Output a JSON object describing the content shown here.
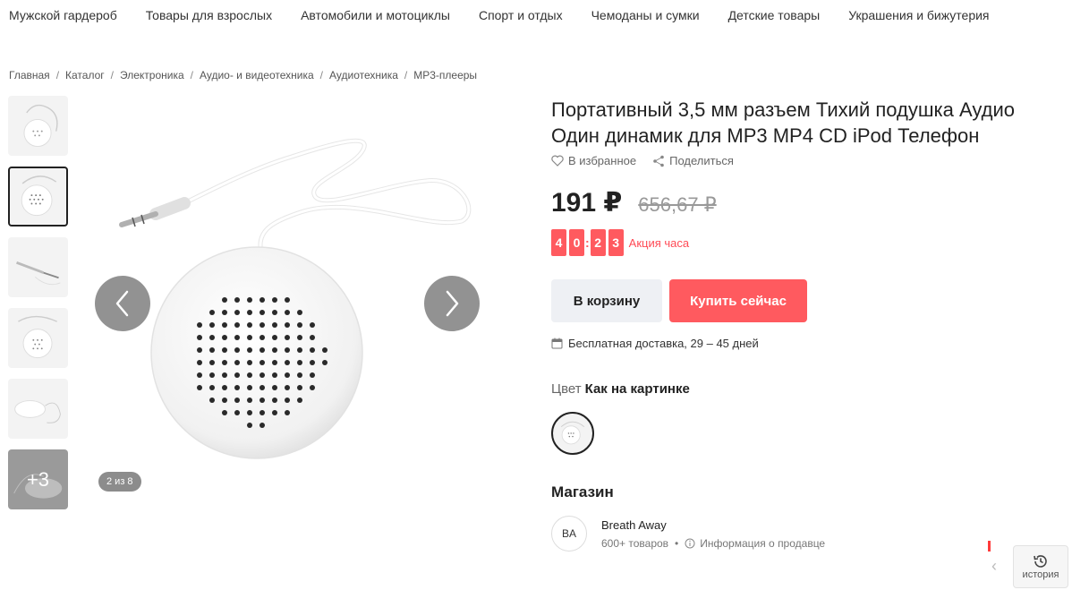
{
  "topnav": [
    "Мужской гардероб",
    "Товары для взрослых",
    "Автомобили и мотоциклы",
    "Спорт и отдых",
    "Чемоданы и сумки",
    "Детские товары",
    "Украшения и бижутерия"
  ],
  "breadcrumbs": [
    "Главная",
    "Каталог",
    "Электроника",
    "Аудио- и видеотехника",
    "Аудиотехника",
    "MP3-плееры"
  ],
  "gallery": {
    "more_label": "+3",
    "counter": "2 из 8"
  },
  "product": {
    "title_line1": "Портативный 3,5 мм разъем Тихий подушка Аудио",
    "title_line2": "Один динамик для MP3 MP4 CD iPod Телефон",
    "favorite_label": "В избранное",
    "share_label": "Поделиться",
    "price": "191 ₽",
    "old_price": "656,67 ₽",
    "timer_digits": [
      "4",
      "0",
      "2",
      "3"
    ],
    "promo_label": "Акция часа",
    "cart_button": "В корзину",
    "buy_button": "Купить сейчас",
    "delivery": "Бесплатная доставка, 29 – 45 дней",
    "color_label": "Цвет",
    "color_value": "Как на картинке"
  },
  "store": {
    "section_title": "Магазин",
    "avatar_text": "BA",
    "name": "Breath Away",
    "items_count": "600+ товаров",
    "seller_info": "Информация о продавце"
  },
  "history_label": "история",
  "colors": {
    "accent": "#ff5a5f",
    "cart_bg": "#eef0f4"
  }
}
